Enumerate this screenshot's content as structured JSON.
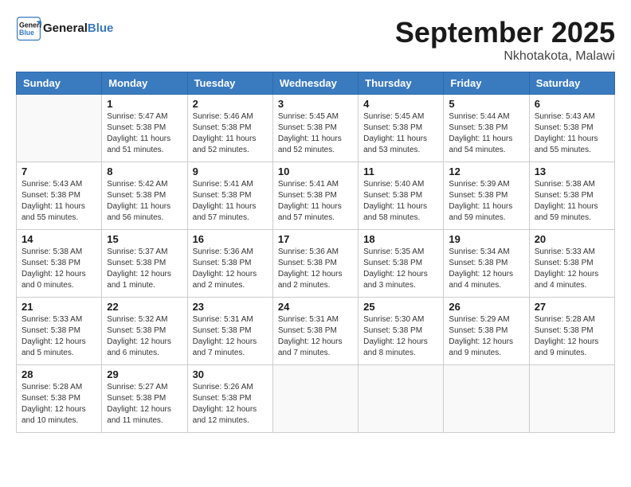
{
  "header": {
    "logo_line1": "General",
    "logo_line2": "Blue",
    "month_title": "September 2025",
    "subtitle": "Nkhotakota, Malawi"
  },
  "weekdays": [
    "Sunday",
    "Monday",
    "Tuesday",
    "Wednesday",
    "Thursday",
    "Friday",
    "Saturday"
  ],
  "weeks": [
    [
      {
        "day": "",
        "info": ""
      },
      {
        "day": "1",
        "info": "Sunrise: 5:47 AM\nSunset: 5:38 PM\nDaylight: 11 hours\nand 51 minutes."
      },
      {
        "day": "2",
        "info": "Sunrise: 5:46 AM\nSunset: 5:38 PM\nDaylight: 11 hours\nand 52 minutes."
      },
      {
        "day": "3",
        "info": "Sunrise: 5:45 AM\nSunset: 5:38 PM\nDaylight: 11 hours\nand 52 minutes."
      },
      {
        "day": "4",
        "info": "Sunrise: 5:45 AM\nSunset: 5:38 PM\nDaylight: 11 hours\nand 53 minutes."
      },
      {
        "day": "5",
        "info": "Sunrise: 5:44 AM\nSunset: 5:38 PM\nDaylight: 11 hours\nand 54 minutes."
      },
      {
        "day": "6",
        "info": "Sunrise: 5:43 AM\nSunset: 5:38 PM\nDaylight: 11 hours\nand 55 minutes."
      }
    ],
    [
      {
        "day": "7",
        "info": "Sunrise: 5:43 AM\nSunset: 5:38 PM\nDaylight: 11 hours\nand 55 minutes."
      },
      {
        "day": "8",
        "info": "Sunrise: 5:42 AM\nSunset: 5:38 PM\nDaylight: 11 hours\nand 56 minutes."
      },
      {
        "day": "9",
        "info": "Sunrise: 5:41 AM\nSunset: 5:38 PM\nDaylight: 11 hours\nand 57 minutes."
      },
      {
        "day": "10",
        "info": "Sunrise: 5:41 AM\nSunset: 5:38 PM\nDaylight: 11 hours\nand 57 minutes."
      },
      {
        "day": "11",
        "info": "Sunrise: 5:40 AM\nSunset: 5:38 PM\nDaylight: 11 hours\nand 58 minutes."
      },
      {
        "day": "12",
        "info": "Sunrise: 5:39 AM\nSunset: 5:38 PM\nDaylight: 11 hours\nand 59 minutes."
      },
      {
        "day": "13",
        "info": "Sunrise: 5:38 AM\nSunset: 5:38 PM\nDaylight: 11 hours\nand 59 minutes."
      }
    ],
    [
      {
        "day": "14",
        "info": "Sunrise: 5:38 AM\nSunset: 5:38 PM\nDaylight: 12 hours\nand 0 minutes."
      },
      {
        "day": "15",
        "info": "Sunrise: 5:37 AM\nSunset: 5:38 PM\nDaylight: 12 hours\nand 1 minute."
      },
      {
        "day": "16",
        "info": "Sunrise: 5:36 AM\nSunset: 5:38 PM\nDaylight: 12 hours\nand 2 minutes."
      },
      {
        "day": "17",
        "info": "Sunrise: 5:36 AM\nSunset: 5:38 PM\nDaylight: 12 hours\nand 2 minutes."
      },
      {
        "day": "18",
        "info": "Sunrise: 5:35 AM\nSunset: 5:38 PM\nDaylight: 12 hours\nand 3 minutes."
      },
      {
        "day": "19",
        "info": "Sunrise: 5:34 AM\nSunset: 5:38 PM\nDaylight: 12 hours\nand 4 minutes."
      },
      {
        "day": "20",
        "info": "Sunrise: 5:33 AM\nSunset: 5:38 PM\nDaylight: 12 hours\nand 4 minutes."
      }
    ],
    [
      {
        "day": "21",
        "info": "Sunrise: 5:33 AM\nSunset: 5:38 PM\nDaylight: 12 hours\nand 5 minutes."
      },
      {
        "day": "22",
        "info": "Sunrise: 5:32 AM\nSunset: 5:38 PM\nDaylight: 12 hours\nand 6 minutes."
      },
      {
        "day": "23",
        "info": "Sunrise: 5:31 AM\nSunset: 5:38 PM\nDaylight: 12 hours\nand 7 minutes."
      },
      {
        "day": "24",
        "info": "Sunrise: 5:31 AM\nSunset: 5:38 PM\nDaylight: 12 hours\nand 7 minutes."
      },
      {
        "day": "25",
        "info": "Sunrise: 5:30 AM\nSunset: 5:38 PM\nDaylight: 12 hours\nand 8 minutes."
      },
      {
        "day": "26",
        "info": "Sunrise: 5:29 AM\nSunset: 5:38 PM\nDaylight: 12 hours\nand 9 minutes."
      },
      {
        "day": "27",
        "info": "Sunrise: 5:28 AM\nSunset: 5:38 PM\nDaylight: 12 hours\nand 9 minutes."
      }
    ],
    [
      {
        "day": "28",
        "info": "Sunrise: 5:28 AM\nSunset: 5:38 PM\nDaylight: 12 hours\nand 10 minutes."
      },
      {
        "day": "29",
        "info": "Sunrise: 5:27 AM\nSunset: 5:38 PM\nDaylight: 12 hours\nand 11 minutes."
      },
      {
        "day": "30",
        "info": "Sunrise: 5:26 AM\nSunset: 5:38 PM\nDaylight: 12 hours\nand 12 minutes."
      },
      {
        "day": "",
        "info": ""
      },
      {
        "day": "",
        "info": ""
      },
      {
        "day": "",
        "info": ""
      },
      {
        "day": "",
        "info": ""
      }
    ]
  ]
}
